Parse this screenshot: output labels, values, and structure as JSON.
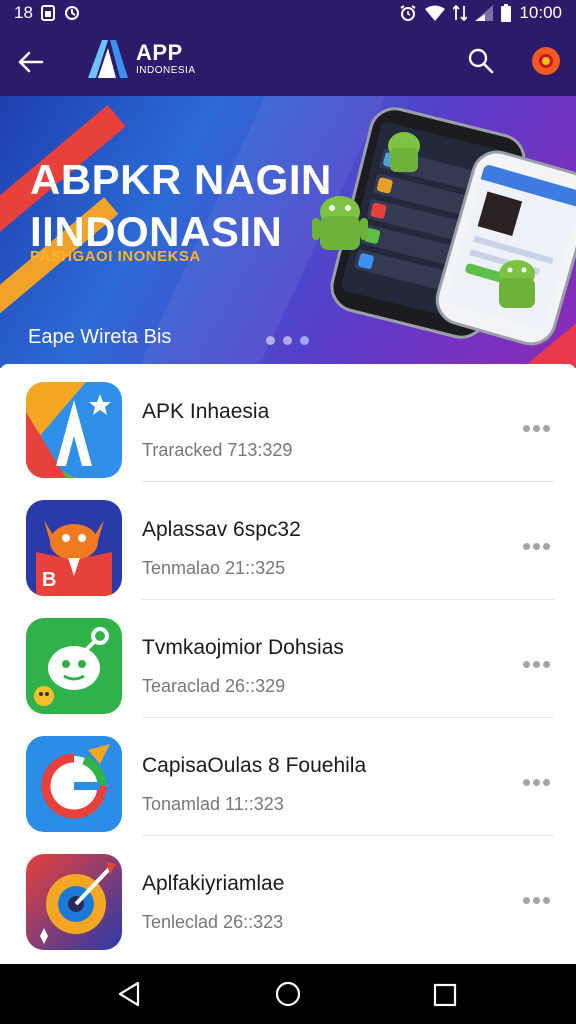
{
  "status_bar": {
    "time_left": "18",
    "time": "10:00"
  },
  "app_bar": {
    "logo_title": "APP",
    "logo_subtitle": "INDONESIA"
  },
  "banner": {
    "title": "ABPKR NAGIN\nIINDONASIN",
    "subtitle": "PASHGAOI INONEKSA",
    "caption": "Eape Wireta Bis",
    "pages": 3,
    "active_page": 3
  },
  "apps": [
    {
      "name": "APK Inhaesia",
      "meta": "Traracked 713:329",
      "icon": "colorful-a-icon"
    },
    {
      "name": "Aplassav 6spc32",
      "meta": "Tenmalao 21::325",
      "icon": "fox-b-icon"
    },
    {
      "name": "Tvmkaojmior Dohsias",
      "meta": "Tearaclad 26::329",
      "icon": "green-robot-icon"
    },
    {
      "name": "CapisaOulas 8 Fouehila",
      "meta": "Tonamlad 11::323",
      "icon": "blue-g-icon"
    },
    {
      "name": "Aplfakiyriamlae",
      "meta": "Tenleclad 26::323",
      "icon": "orange-compass-icon"
    }
  ],
  "colors": {
    "app_bar": "#2c1b6b",
    "accent_orange": "#f05a22"
  }
}
